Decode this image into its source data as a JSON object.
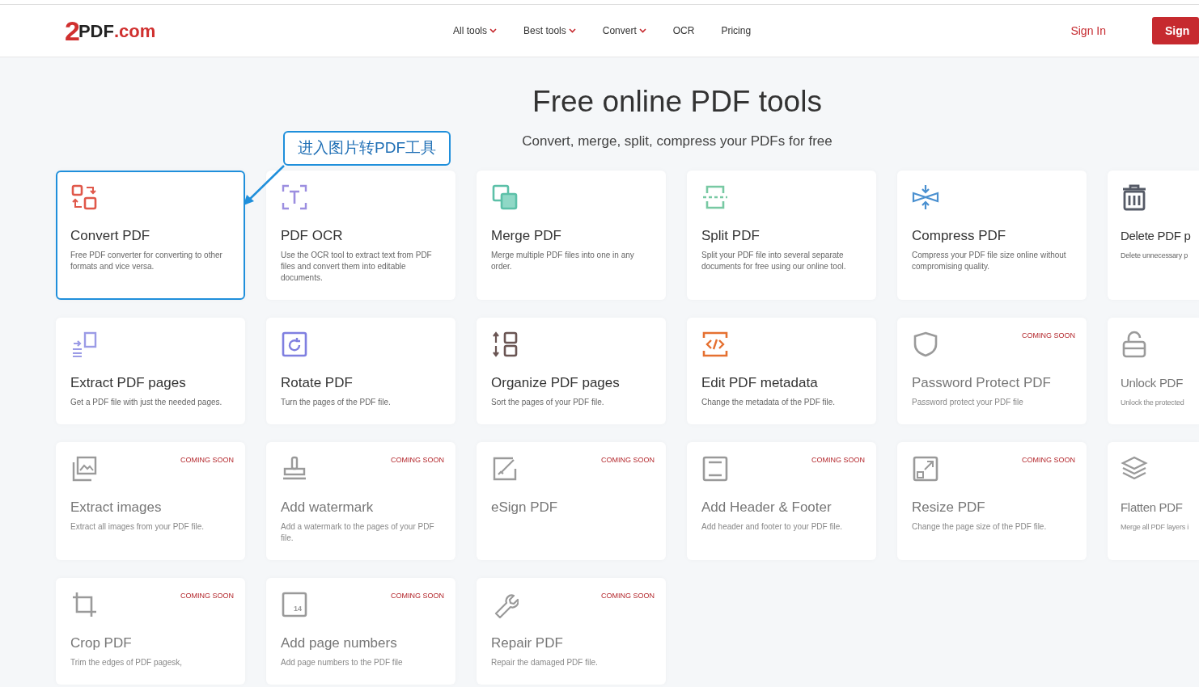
{
  "header": {
    "logo": {
      "digit": "2",
      "text": "PDF",
      "suffix": ".com"
    },
    "nav": [
      {
        "label": "All tools",
        "dropdown": true
      },
      {
        "label": "Best tools",
        "dropdown": true
      },
      {
        "label": "Convert",
        "dropdown": true
      },
      {
        "label": "OCR",
        "dropdown": false
      },
      {
        "label": "Pricing",
        "dropdown": false
      }
    ],
    "sign_in": "Sign In",
    "sign_up": "Sign"
  },
  "hero": {
    "title": "Free online PDF tools",
    "subtitle": "Convert, merge, split, compress your PDFs for free"
  },
  "annotation": {
    "text": "进入图片转PDF工具"
  },
  "tools": [
    {
      "title": "Convert PDF",
      "description": "Free PDF converter for converting to other formats and vice versa.",
      "highlighted": true,
      "disabled": false
    },
    {
      "title": "PDF OCR",
      "description": "Use the OCR tool to extract text from PDF files and convert them into editable documents.",
      "highlighted": false,
      "disabled": false
    },
    {
      "title": "Merge PDF",
      "description": "Merge multiple PDF files into one in any order.",
      "highlighted": false,
      "disabled": false
    },
    {
      "title": "Split PDF",
      "description": "Split your PDF file into several separate documents for free using our online tool.",
      "highlighted": false,
      "disabled": false
    },
    {
      "title": "Compress PDF",
      "description": "Compress your PDF file size online without compromising quality.",
      "highlighted": false,
      "disabled": false
    },
    {
      "title": "Delete PDF p",
      "description": "Delete unnecessary p",
      "highlighted": false,
      "disabled": false
    },
    {
      "title": "Extract PDF pages",
      "description": "Get a PDF file with just the needed pages.",
      "highlighted": false,
      "disabled": false
    },
    {
      "title": "Rotate PDF",
      "description": "Turn the pages of the PDF file.",
      "highlighted": false,
      "disabled": false
    },
    {
      "title": "Organize PDF pages",
      "description": "Sort the pages of your PDF file.",
      "highlighted": false,
      "disabled": false
    },
    {
      "title": "Edit PDF metadata",
      "description": "Change the metadata of the PDF file.",
      "highlighted": false,
      "disabled": false
    },
    {
      "title": "Password Protect PDF",
      "description": "Password protect your PDF file",
      "badge": "COMING SOON",
      "highlighted": false,
      "disabled": true
    },
    {
      "title": "Unlock PDF",
      "description": "Unlock the protected",
      "highlighted": false,
      "disabled": true
    },
    {
      "title": "Extract images",
      "description": "Extract all images from your PDF file.",
      "badge": "COMING SOON",
      "highlighted": false,
      "disabled": true
    },
    {
      "title": "Add watermark",
      "description": "Add a watermark to the pages of your PDF file.",
      "badge": "COMING SOON",
      "highlighted": false,
      "disabled": true
    },
    {
      "title": "eSign PDF",
      "badge": "COMING SOON",
      "highlighted": false,
      "disabled": true
    },
    {
      "title": "Add Header & Footer",
      "description": "Add header and footer to your PDF file.",
      "badge": "COMING SOON",
      "highlighted": false,
      "disabled": true
    },
    {
      "title": "Resize PDF",
      "description": "Change the page size of the PDF file.",
      "badge": "COMING SOON",
      "highlighted": false,
      "disabled": true
    },
    {
      "title": "Flatten PDF",
      "description": "Merge all PDF layers i",
      "highlighted": false,
      "disabled": true
    },
    {
      "title": "Crop PDF",
      "description": "Trim the edges of PDF pagesk,",
      "badge": "COMING SOON",
      "highlighted": false,
      "disabled": true
    },
    {
      "title": "Add page numbers",
      "description": "Add page numbers to the PDF file",
      "badge": "COMING SOON",
      "highlighted": false,
      "disabled": true,
      "icon_text": "14"
    },
    {
      "title": "Repair PDF",
      "description": "Repair the damaged PDF file.",
      "badge": "COMING SOON",
      "highlighted": false,
      "disabled": true
    }
  ]
}
